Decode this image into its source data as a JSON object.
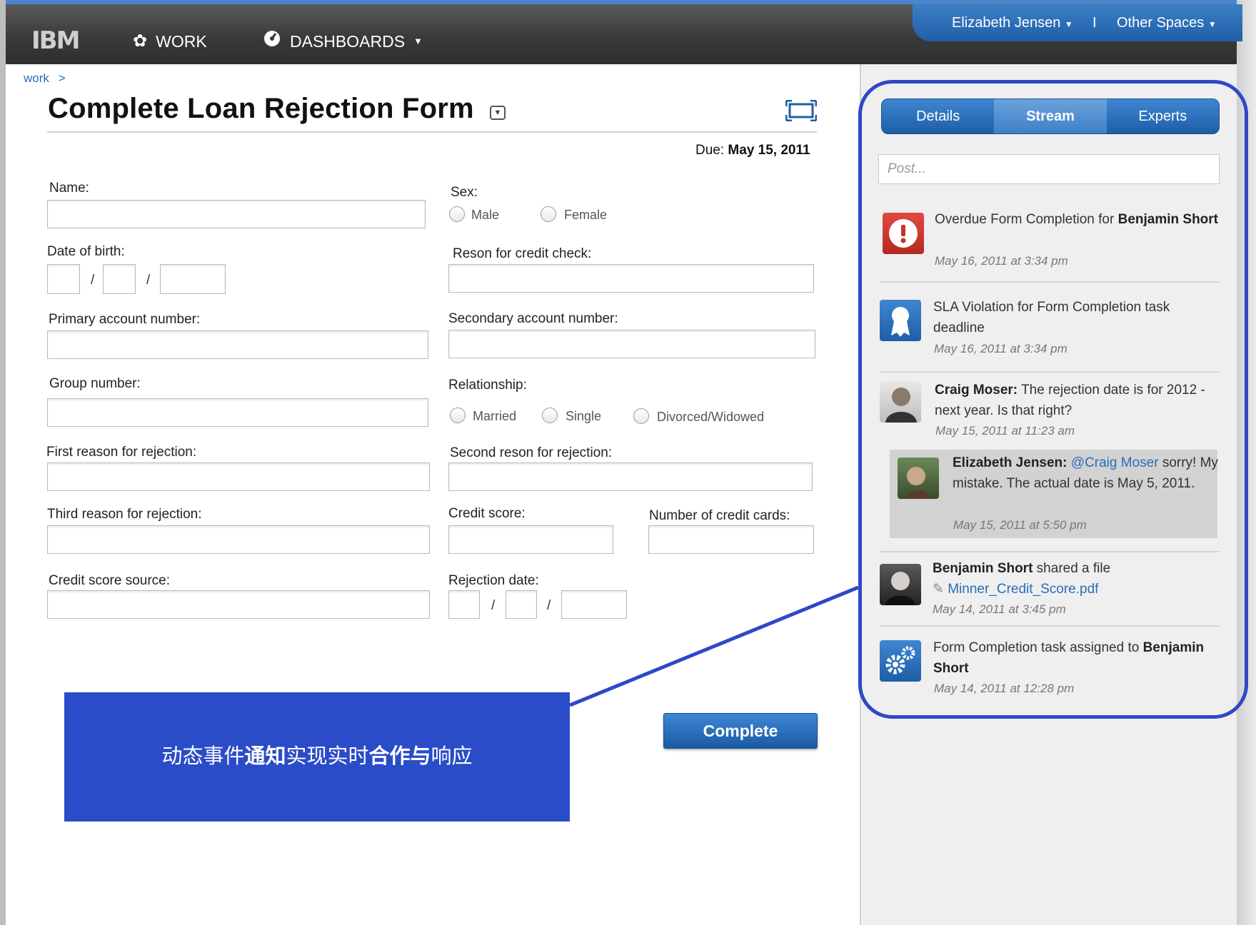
{
  "topbar": {
    "logo": "IBM",
    "nav": [
      {
        "label": "WORK",
        "icon": "gear-icon"
      },
      {
        "label": "DASHBOARDS",
        "icon": "gauge-icon"
      }
    ],
    "user": "Elizabeth Jensen",
    "separator": "I",
    "spaces": "Other Spaces"
  },
  "breadcrumb": {
    "item": "work",
    "separator": ">"
  },
  "page": {
    "title": "Complete Loan Rejection Form",
    "due_label": "Due:",
    "due_date": "May 15, 2011"
  },
  "form": {
    "name": "Name:",
    "sex": "Sex:",
    "sex_options": [
      "Male",
      "Female"
    ],
    "dob": "Date of birth:",
    "reason_credit_check": "Reson for credit check:",
    "primary_account": "Primary account number:",
    "secondary_account": "Secondary account number:",
    "group_number": "Group number:",
    "relationship": "Relationship:",
    "relationship_options": [
      "Married",
      "Single",
      "Divorced/Widowed"
    ],
    "first_reason": "First reason for rejection:",
    "second_reason": "Second reson for rejection:",
    "third_reason": "Third reason for rejection:",
    "credit_score": "Credit score:",
    "num_cards": "Number of credit cards:",
    "credit_score_source": "Credit score source:",
    "rejection_date": "Rejection date:",
    "date_separator": "/",
    "complete": "Complete"
  },
  "callout": {
    "part1": "动态事件",
    "part2": "通知",
    "part3": "实现实时",
    "part4": "合作与",
    "part5": "响应"
  },
  "sidebar": {
    "tabs": [
      "Details",
      "Stream",
      "Experts"
    ],
    "active_tab": "Stream",
    "post_placeholder": "Post...",
    "feed": [
      {
        "icon": "alert-icon",
        "text": "Overdue Form Completion for ",
        "bold": "Benjamin Short",
        "time": "May 16, 2011 at 3:34 pm"
      },
      {
        "icon": "ribbon-icon",
        "text": "SLA Violation for Form Completion task deadline",
        "time": "May 16, 2011 at 3:34 pm"
      },
      {
        "icon": "avatar",
        "bold": "Craig Moser:",
        "text": " The rejection date is for 2012 - next year. Is that right?",
        "time": "May 15, 2011 at 11:23 am"
      },
      {
        "icon": "avatar",
        "bold": "Elizabeth Jensen:",
        "mention": "@Craig Moser",
        "text": " sorry! My mistake. The actual date is May 5, 2011.",
        "time": "May 15, 2011 at 5:50 pm"
      },
      {
        "icon": "avatar",
        "bold": "Benjamin Short",
        "text": " shared a file",
        "file": "Minner_Credit_Score.pdf",
        "time": "May 14, 2011 at 3:45 pm"
      },
      {
        "icon": "gears-icon",
        "text": "Form Completion task assigned to ",
        "bold": "Benjamin Short",
        "time": "May 14, 2011 at 12:28 pm"
      }
    ]
  },
  "colors": {
    "accent": "#1f5fa7",
    "callout": "#2a4cc8",
    "alert": "#c8322a"
  }
}
